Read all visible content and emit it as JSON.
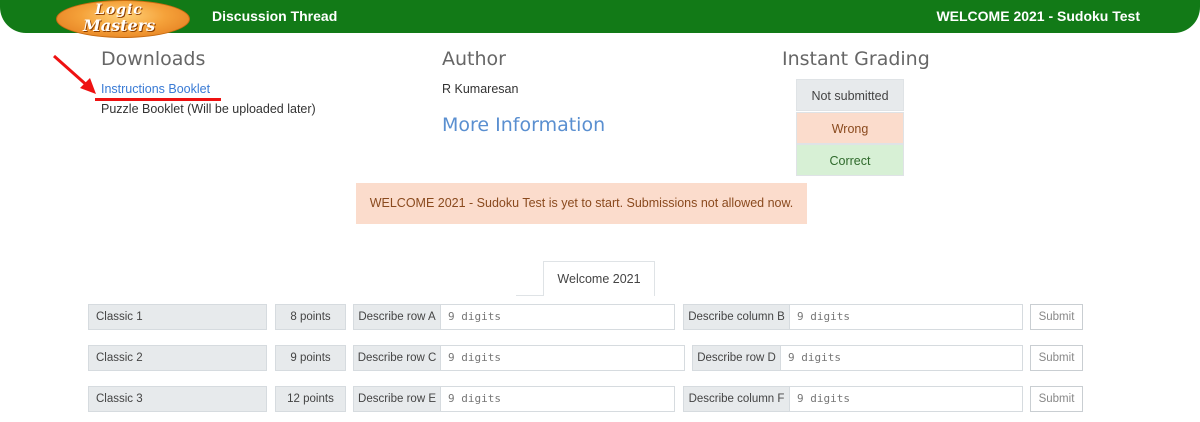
{
  "header": {
    "logo_line1": "Logic",
    "logo_line2": "Masters",
    "left_link": "Discussion Thread",
    "right_title": "WELCOME 2021 - Sudoku Test"
  },
  "downloads": {
    "title": "Downloads",
    "instructions": "Instructions Booklet",
    "puzzle": "Puzzle Booklet (Will be uploaded later)"
  },
  "author": {
    "title": "Author",
    "name": "R Kumaresan",
    "more": "More Information"
  },
  "grading": {
    "title": "Instant Grading",
    "not_submitted": "Not submitted",
    "wrong": "Wrong",
    "correct": "Correct"
  },
  "notice": "WELCOME 2021 - Sudoku Test is yet to start. Submissions not allowed now.",
  "tab": "Welcome 2021",
  "rows": [
    {
      "label": "Classic 1",
      "points": "8 points",
      "a_label": "Describe row A",
      "a_placeholder": "9 digits",
      "b_label": "Describe column B",
      "b_placeholder": "9 digits",
      "submit": "Submit"
    },
    {
      "label": "Classic 2",
      "points": "9 points",
      "a_label": "Describe row C",
      "a_placeholder": "9 digits",
      "b_label": "Describe row D",
      "b_placeholder": "9 digits",
      "submit": "Submit"
    },
    {
      "label": "Classic 3",
      "points": "12 points",
      "a_label": "Describe row E",
      "a_placeholder": "9 digits",
      "b_label": "Describe column F",
      "b_placeholder": "9 digits",
      "submit": "Submit"
    }
  ],
  "colors": {
    "header_green": "#127a17",
    "link_blue": "#3a7bd5",
    "wrong_bg": "#fbdccc",
    "correct_bg": "#d7f0d5",
    "annotation_red": "#e11111"
  }
}
